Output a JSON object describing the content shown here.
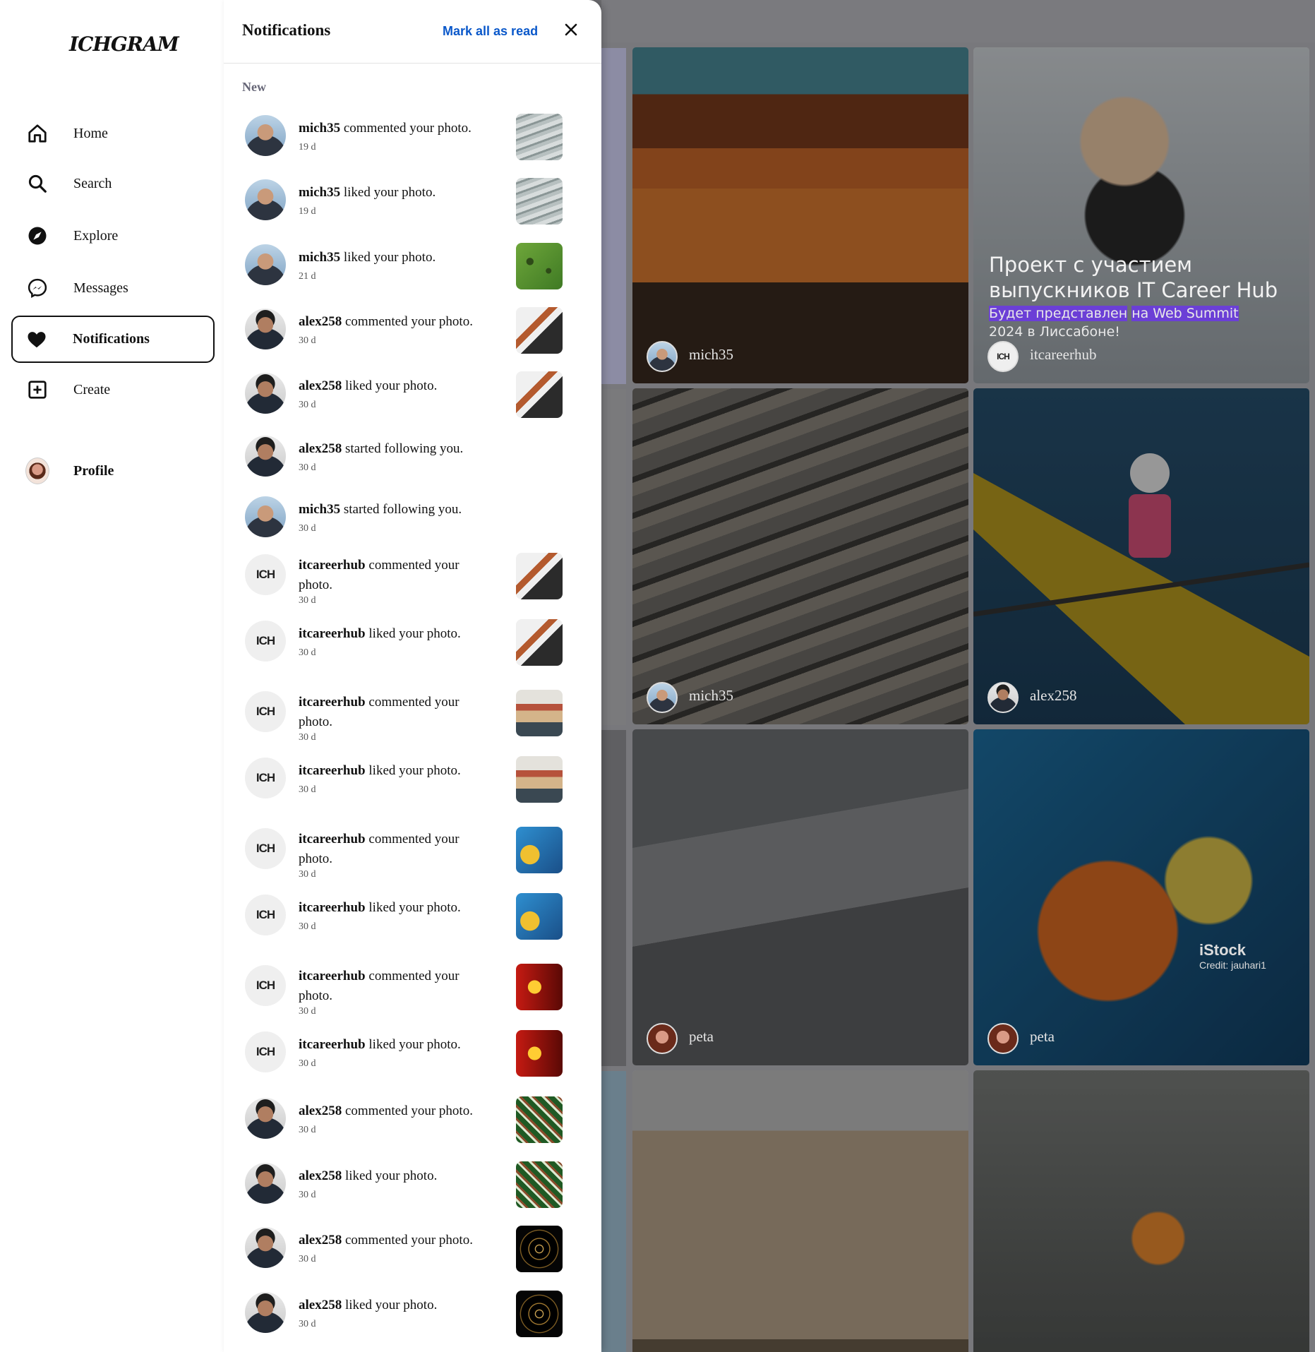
{
  "sidebar": {
    "logo": "ICHGRAM",
    "items": [
      {
        "label": "Home",
        "icon": "home-icon"
      },
      {
        "label": "Search",
        "icon": "search-icon"
      },
      {
        "label": "Explore",
        "icon": "compass-icon"
      },
      {
        "label": "Messages",
        "icon": "messenger-icon"
      },
      {
        "label": "Notifications",
        "icon": "heart-icon",
        "active": true
      },
      {
        "label": "Create",
        "icon": "plus-square-icon"
      },
      {
        "label": "Profile",
        "icon": "profile-avatar"
      }
    ]
  },
  "panel": {
    "title": "Notifications",
    "mark_all": "Mark all as read",
    "close_icon": "close-icon",
    "section": "New"
  },
  "notifications": [
    {
      "user": "mich35",
      "action": "commented your photo.",
      "time": "19 d",
      "avatar": "person",
      "thumb": "glass"
    },
    {
      "user": "mich35",
      "action": "liked your photo.",
      "time": "19 d",
      "avatar": "person",
      "thumb": "glass"
    },
    {
      "user": "mich35",
      "action": "liked your photo.",
      "time": "21 d",
      "avatar": "person",
      "thumb": "grass"
    },
    {
      "user": "alex258",
      "action": "commented your photo.",
      "time": "30 d",
      "avatar": "alex",
      "thumb": "man"
    },
    {
      "user": "alex258",
      "action": "liked your photo.",
      "time": "30 d",
      "avatar": "alex",
      "thumb": "man"
    },
    {
      "user": "alex258",
      "action": "started following you.",
      "time": "30 d",
      "avatar": "alex",
      "thumb": ""
    },
    {
      "user": "mich35",
      "action": "started following you.",
      "time": "30 d",
      "avatar": "person",
      "thumb": ""
    },
    {
      "user": "itcareerhub",
      "action": "commented your photo.",
      "time": "30 d",
      "avatar": "ich",
      "thumb": "man"
    },
    {
      "user": "itcareerhub",
      "action": "liked your photo.",
      "time": "30 d",
      "avatar": "ich",
      "thumb": "man"
    },
    {
      "user": "itcareerhub",
      "action": "commented your photo.",
      "time": "30 d",
      "avatar": "ich",
      "thumb": "street"
    },
    {
      "user": "itcareerhub",
      "action": "liked your photo.",
      "time": "30 d",
      "avatar": "ich",
      "thumb": "street"
    },
    {
      "user": "itcareerhub",
      "action": "commented your photo.",
      "time": "30 d",
      "avatar": "ich",
      "thumb": "sign"
    },
    {
      "user": "itcareerhub",
      "action": "liked your photo.",
      "time": "30 d",
      "avatar": "ich",
      "thumb": "sign"
    },
    {
      "user": "itcareerhub",
      "action": "commented your photo.",
      "time": "30 d",
      "avatar": "ich",
      "thumb": "neon"
    },
    {
      "user": "itcareerhub",
      "action": "liked your photo.",
      "time": "30 d",
      "avatar": "ich",
      "thumb": "neon"
    },
    {
      "user": "alex258",
      "action": "commented your photo.",
      "time": "30 d",
      "avatar": "alex",
      "thumb": "tree"
    },
    {
      "user": "alex258",
      "action": "liked your photo.",
      "time": "30 d",
      "avatar": "alex",
      "thumb": "tree"
    },
    {
      "user": "alex258",
      "action": "commented your photo.",
      "time": "30 d",
      "avatar": "alex",
      "thumb": "tunnel"
    },
    {
      "user": "alex258",
      "action": "liked your photo.",
      "time": "30 d",
      "avatar": "alex",
      "thumb": "tunnel"
    }
  ],
  "ich_avatar_text": "ICH",
  "feed": {
    "posts": [
      {
        "user": "mich35"
      },
      {
        "user": "itcareerhub",
        "promo_title": "Проект с участием выпускников IT Career Hub",
        "promo_sub_1": "Будет представлен",
        "promo_sub_hl": "на Web Summit",
        "promo_sub_2": "2024 в Лиссабоне!"
      },
      {
        "user": "mich35"
      },
      {
        "user": "alex258"
      },
      {
        "user": "peta"
      },
      {
        "user": "peta",
        "watermark": "iStock",
        "credit": "Credit: jauhari1"
      },
      {
        "user": ""
      },
      {
        "user": ""
      }
    ]
  },
  "colors": {
    "accent": "#0a58ca",
    "overlay": "#6c6c70"
  }
}
